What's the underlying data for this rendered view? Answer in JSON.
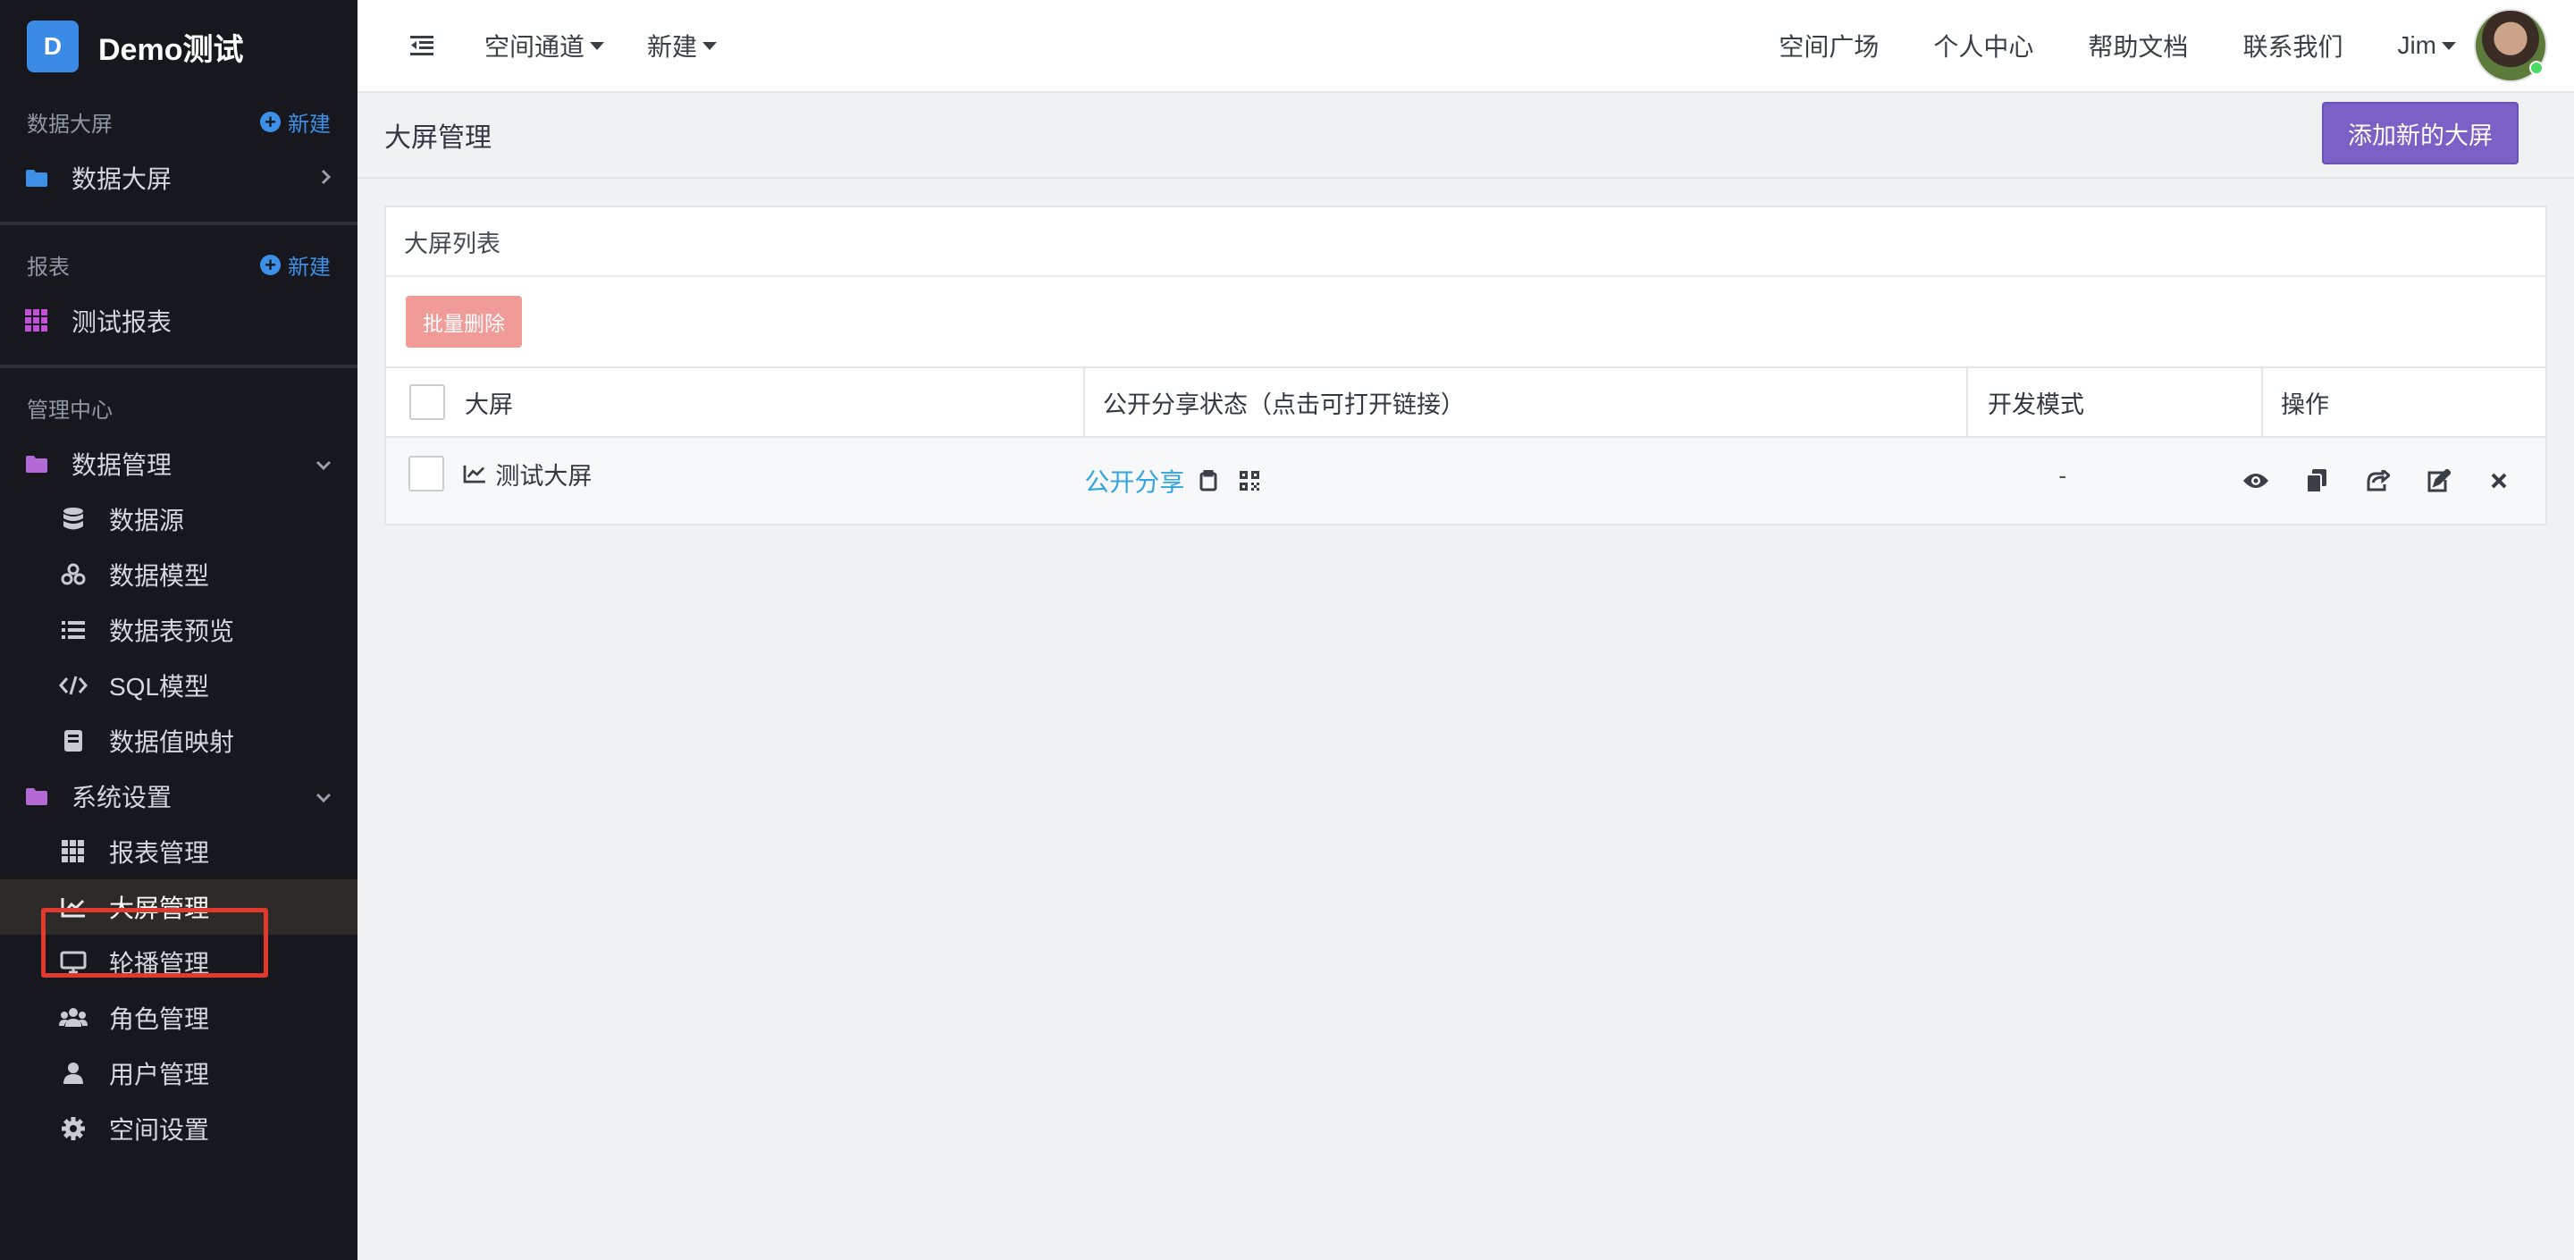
{
  "brand": {
    "logo_letter": "D",
    "title": "Demo测试",
    "accent": "#3b8be6"
  },
  "sidebar": {
    "sections": [
      {
        "title": "数据大屏",
        "new_label": "新建",
        "items": [
          {
            "label": "数据大屏",
            "icon": "folder-icon"
          }
        ]
      },
      {
        "title": "报表",
        "new_label": "新建",
        "items": [
          {
            "label": "测试报表",
            "icon": "grid-icon"
          }
        ]
      },
      {
        "title": "管理中心"
      }
    ],
    "data_mgmt": {
      "label": "数据管理",
      "items": [
        {
          "label": "数据源",
          "icon": "database-icon"
        },
        {
          "label": "数据模型",
          "icon": "cubes-icon"
        },
        {
          "label": "数据表预览",
          "icon": "list-icon"
        },
        {
          "label": "SQL模型",
          "icon": "code-icon"
        },
        {
          "label": "数据值映射",
          "icon": "book-icon"
        }
      ]
    },
    "sys_settings": {
      "label": "系统设置",
      "items": [
        {
          "label": "报表管理",
          "icon": "grid-icon"
        },
        {
          "label": "大屏管理",
          "icon": "area-chart-icon",
          "active": true
        },
        {
          "label": "轮播管理",
          "icon": "monitor-icon"
        },
        {
          "label": "角色管理",
          "icon": "users-icon"
        },
        {
          "label": "用户管理",
          "icon": "user-icon"
        },
        {
          "label": "空间设置",
          "icon": "gear-icon"
        }
      ]
    }
  },
  "topbar": {
    "menus": [
      "空间通道",
      "新建"
    ],
    "links": [
      "空间广场",
      "个人中心",
      "帮助文档",
      "联系我们"
    ],
    "user": "Jim"
  },
  "page": {
    "title": "大屏管理",
    "add_button": "添加新的大屏",
    "accent": "#7b61c6"
  },
  "card": {
    "title": "大屏列表",
    "batch_delete": "批量删除",
    "columns": [
      "大屏",
      "公开分享状态（点击可打开链接）",
      "开发模式",
      "操作"
    ],
    "rows": [
      {
        "name": "测试大屏",
        "share": "公开分享",
        "dev_mode": "-"
      }
    ]
  }
}
